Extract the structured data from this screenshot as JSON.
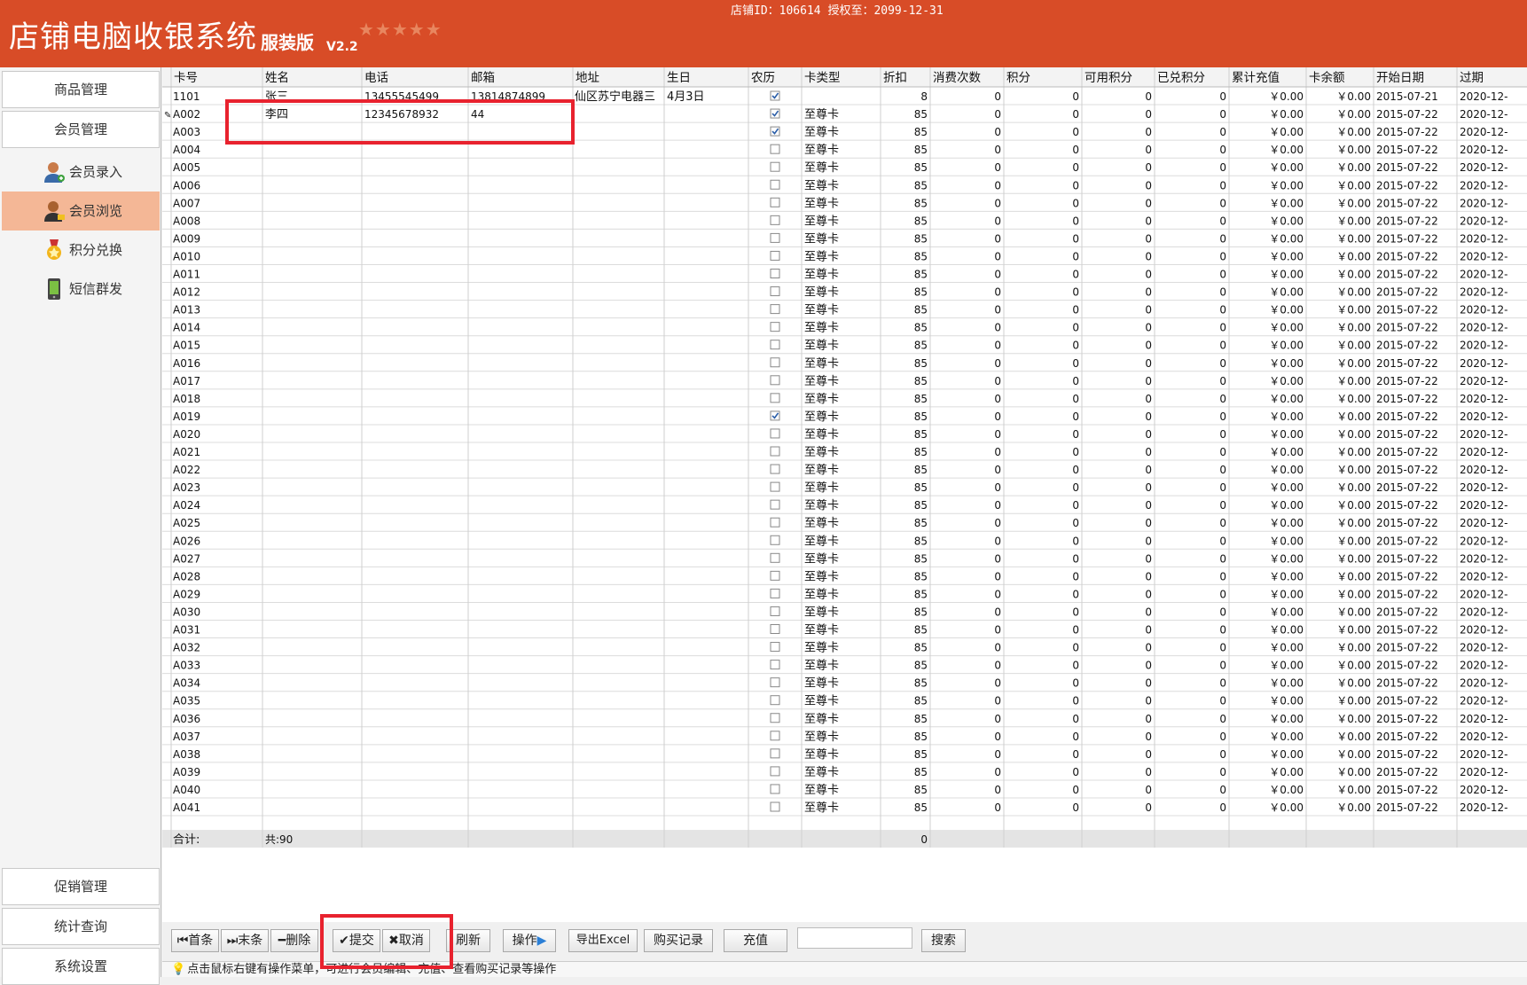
{
  "header": {
    "title": "店铺电脑收银系统",
    "edition": "服装版",
    "version": "V2.2",
    "stars": "★★★★★",
    "shop_info": "店铺ID：106614 授权至：2099-12-31",
    "background_color": "#d84c27"
  },
  "sidebar": {
    "sections_top": [
      {
        "label": "商品管理"
      },
      {
        "label": "会员管理"
      }
    ],
    "sub_items": [
      {
        "label": "会员录入",
        "icon": "user-add-icon",
        "active": false
      },
      {
        "label": "会员浏览",
        "icon": "user-vip-icon",
        "active": true
      },
      {
        "label": "积分兑换",
        "icon": "medal-icon",
        "active": false
      },
      {
        "label": "短信群发",
        "icon": "phone-sms-icon",
        "active": false
      }
    ],
    "sections_bottom": [
      {
        "label": "促销管理"
      },
      {
        "label": "统计查询"
      },
      {
        "label": "系统设置"
      }
    ],
    "active_color": "#f4b796"
  },
  "grid": {
    "columns": [
      "卡号",
      "姓名",
      "电话",
      "邮箱",
      "地址",
      "生日",
      "农历",
      "卡类型",
      "折扣",
      "消费次数",
      "积分",
      "可用积分",
      "已兑积分",
      "累计充值",
      "卡余额",
      "开始日期",
      "过期"
    ],
    "rows_special": [
      {
        "card": "1101",
        "name": "张三",
        "phone": "13455545499",
        "email": "13814874899",
        "address": "仙区苏宁电器三",
        "birthday": "4月3日",
        "lunar": true,
        "card_type": "",
        "discount": "8",
        "count": "0",
        "points": "0",
        "avail": "0",
        "redeemed": "0",
        "recharge": "￥0.00",
        "balance": "￥0.00",
        "start": "2015-07-21",
        "expire": "2020-12-"
      },
      {
        "card": "A002",
        "name": "李四",
        "phone": "12345678932",
        "email": "44",
        "address": "",
        "birthday": "",
        "lunar": true,
        "card_type": "至尊卡",
        "discount": "85",
        "count": "0",
        "points": "0",
        "avail": "0",
        "redeemed": "0",
        "recharge": "￥0.00",
        "balance": "￥0.00",
        "start": "2015-07-22",
        "expire": "2020-12-"
      }
    ],
    "default_row": {
      "card_type": "至尊卡",
      "discount": "85",
      "count": "0",
      "points": "0",
      "avail": "0",
      "redeemed": "0",
      "recharge": "￥0.00",
      "balance": "￥0.00",
      "start": "2015-07-22",
      "expire": "2020-12-"
    },
    "range_card_prefix": "A0",
    "range_start": 3,
    "range_end": 41,
    "lunar_checked_cards": [
      "A003",
      "A019"
    ],
    "footer": {
      "label": "合计:",
      "count": "共:90",
      "total": "0"
    }
  },
  "toolbar": {
    "first": "首条",
    "last": "末条",
    "delete": "删除",
    "submit": "提交",
    "cancel": "取消",
    "refresh": "刷新",
    "operate": "操作",
    "export": "导出Excel",
    "purchase": "购买记录",
    "recharge": "充值",
    "search_value": "",
    "search": "搜索"
  },
  "status": {
    "hint": "点击鼠标右键有操作菜单，可进行会员编辑、充值、查看购买记录等操作"
  }
}
